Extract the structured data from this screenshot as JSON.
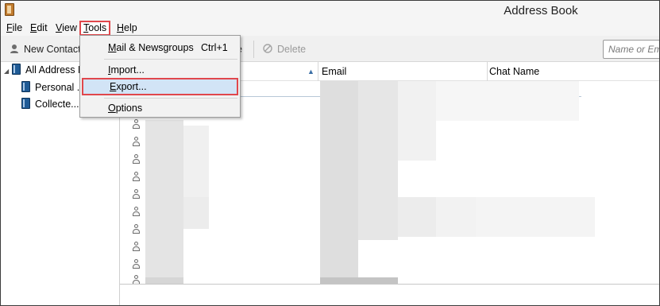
{
  "window": {
    "title": "Address Book"
  },
  "menubar": {
    "file": {
      "pre": "",
      "key": "F",
      "post": "ile"
    },
    "edit": {
      "pre": "",
      "key": "E",
      "post": "dit"
    },
    "view": {
      "pre": "",
      "key": "V",
      "post": "iew"
    },
    "tools": {
      "pre": "",
      "key": "T",
      "post": "ools"
    },
    "help": {
      "pre": "",
      "key": "H",
      "post": "elp"
    }
  },
  "tools_menu": {
    "mail": {
      "pre": "",
      "key": "M",
      "post": "ail & Newsgroups",
      "shortcut": "Ctrl+1"
    },
    "import": {
      "pre": "",
      "key": "I",
      "post": "mport..."
    },
    "export": {
      "pre": "",
      "key": "E",
      "post": "xport..."
    },
    "options": {
      "pre": "",
      "key": "O",
      "post": "ptions"
    }
  },
  "toolbar": {
    "new_contact": "New Contact",
    "partial_label": "e",
    "delete": "Delete",
    "search_placeholder": "Name or Em",
    "icons": {
      "new_contact": "add-person-icon",
      "delete": "delete-icon"
    }
  },
  "tree": {
    "all": "All Address B",
    "personal": "Personal ..",
    "collected": "Collecte...d"
  },
  "list": {
    "columns": {
      "name": "",
      "email": "Email",
      "chat": "Chat Name"
    },
    "contact_row_count": 10
  },
  "colors": {
    "highlight_border": "#e0474c",
    "menu_highlight": "#d2e4f6"
  }
}
